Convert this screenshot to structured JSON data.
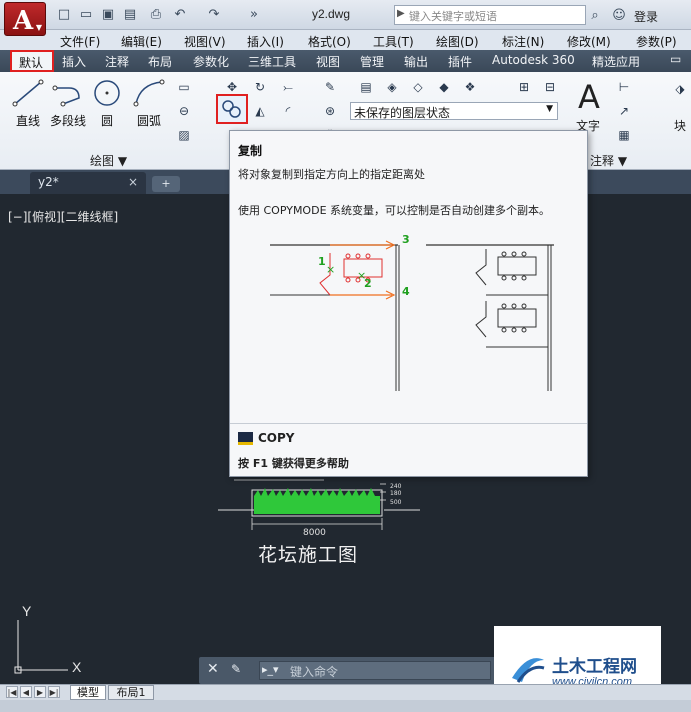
{
  "app": {
    "logo": "A",
    "doc_title": "y2.dwg"
  },
  "search": {
    "placeholder": "键入关键字或短语"
  },
  "user": {
    "login": "登录"
  },
  "menu": [
    "文件(F)",
    "编辑(E)",
    "视图(V)",
    "插入(I)",
    "格式(O)",
    "工具(T)",
    "绘图(D)",
    "标注(N)",
    "修改(M)",
    "参数(P)"
  ],
  "ribbon_tabs": [
    "默认",
    "插入",
    "注释",
    "布局",
    "参数化",
    "三维工具",
    "视图",
    "管理",
    "输出",
    "插件",
    "Autodesk 360",
    "精选应用"
  ],
  "active_ribbon_tab": "默认",
  "draw_tools": {
    "line": "直线",
    "polyline": "多段线",
    "circle": "圆",
    "arc": "圆弧"
  },
  "panels": {
    "draw": "绘图 ▼",
    "annotation": "注释 ▼"
  },
  "layer": {
    "state": "未保存的图层状态"
  },
  "text_tool": {
    "glyph": "A",
    "label": "文字"
  },
  "block_tool": {
    "label": "块"
  },
  "document_tab": {
    "name": "y2*",
    "close": "×"
  },
  "viewport_label": "[−][俯视][二维线框]",
  "tooltip": {
    "title": "复制",
    "description": "将对象复制到指定方向上的指定距离处",
    "detail": "使用 COPYMODE 系统变量，可以控制是否自动创建多个副本。",
    "illustration_labels": [
      "1",
      "2",
      "3",
      "4"
    ],
    "command": "COPY",
    "help": "按 F1 键获得更多帮助"
  },
  "drawing": {
    "title": "花坛施工图",
    "dimension": "8000",
    "dim_labels": [
      "240",
      "180",
      "500"
    ]
  },
  "commandline": {
    "placeholder": "键入命令"
  },
  "ucs": {
    "x": "X",
    "y": "Y"
  },
  "layout_tabs": {
    "model": "模型",
    "layout1": "布局1"
  },
  "watermark": {
    "name": "土木工程网",
    "url": "www.civilcn.com"
  },
  "colors": {
    "highlight": "#e02020",
    "canvas": "#212830",
    "grass": "#2fc83a",
    "tooltip_red": "#e03030",
    "tooltip_green": "#20a020",
    "tooltip_orange": "#f07020"
  }
}
